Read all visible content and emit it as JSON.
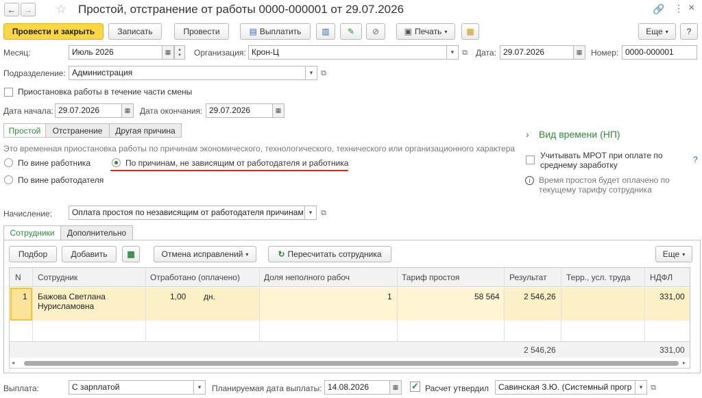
{
  "window": {
    "title": "Простой, отстранение от работы 0000-000001 от 29.07.2026"
  },
  "toolbar": {
    "post_close": "Провести и закрыть",
    "save": "Записать",
    "post": "Провести",
    "pay": "Выплатить",
    "print": "Печать",
    "more": "Еще"
  },
  "header": {
    "month_label": "Месяц:",
    "month_value": "Июль 2026",
    "org_label": "Организация:",
    "org_value": "Крон-Ц",
    "date_label": "Дата:",
    "date_value": "29.07.2026",
    "number_label": "Номер:",
    "number_value": "0000-000001",
    "dept_label": "Подразделение:",
    "dept_value": "Администрация",
    "partial_shift": "Приостановка работы в течение части смены",
    "start_label": "Дата начала:",
    "start_value": "29.07.2026",
    "end_label": "Дата окончания:",
    "end_value": "29.07.2026"
  },
  "reason_tabs": [
    "Простой",
    "Отстранение",
    "Другая причина"
  ],
  "description": "Это временная приостановка работы по причинам экономического, технологического, технического или организационного характера",
  "radios": {
    "worker": "По вине работника",
    "independent": "По причинам, не зависящим от работодателя и работника",
    "employer": "По вине работодателя"
  },
  "side": {
    "time_type": "Вид времени (НП)",
    "mrot": "Учитывать МРОТ при оплате по среднему заработку",
    "help": "?",
    "info": "Время простоя будет оплачено по текущему тарифу сотрудника"
  },
  "accrual": {
    "label": "Начисление:",
    "value": "Оплата простоя по независящим от работодателя причинам"
  },
  "main_tabs": [
    "Сотрудники",
    "Дополнительно"
  ],
  "grid_toolbar": {
    "pick": "Подбор",
    "add": "Добавить",
    "cancel_fixes": "Отмена исправлений",
    "recalc": "Пересчитать сотрудника",
    "more": "Еще"
  },
  "table": {
    "columns": [
      "N",
      "Сотрудник",
      "Отработано (оплачено)",
      "Доля неполного рабоч",
      "Тариф простоя",
      "Результат",
      "Терр., усл. труда",
      "НДФЛ"
    ],
    "rows": [
      {
        "n": "1",
        "employee": "Бажова Светлана Нурисламовна",
        "worked": "1,00",
        "unit": "дн.",
        "share": "1",
        "rate": "58 564",
        "result": "2 546,26",
        "terr": "",
        "ndfl": "331,00"
      }
    ],
    "totals": {
      "result": "2 546,26",
      "ndfl": "331,00"
    }
  },
  "footer": {
    "pay_label": "Выплата:",
    "pay_value": "С зарплатой",
    "plan_label": "Планируемая дата выплаты:",
    "plan_value": "14.08.2026",
    "approved": "Расчет утвердил",
    "approver": "Савинская З.Ю. (Системный прогр"
  }
}
